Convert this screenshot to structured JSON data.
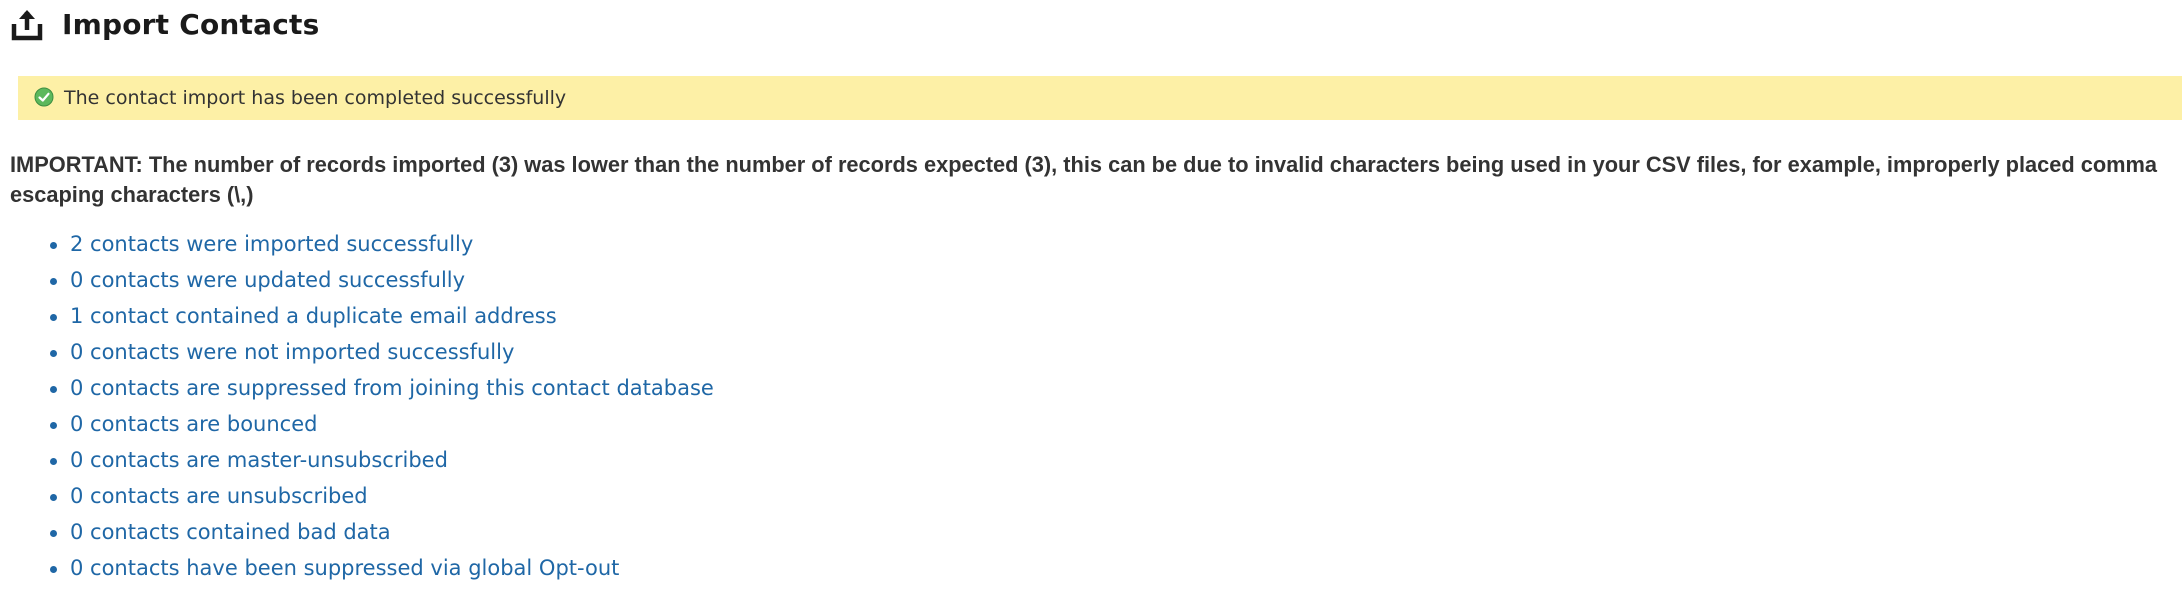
{
  "header": {
    "title": "Import Contacts",
    "icon": "upload-tray-icon"
  },
  "notice": {
    "icon": "success-check-icon",
    "text": "The contact import has been completed successfully",
    "background": "#fdf0a6",
    "icon_color": "#4caf50"
  },
  "important_text": "IMPORTANT: The number of records imported (3) was lower than the number of records expected (3), this can be due to invalid characters being used in your CSV files, for example, improperly placed comma escaping characters (\\,)",
  "results": [
    "2 contacts were imported successfully",
    "0 contacts were updated successfully",
    "1 contact contained a duplicate email address",
    "0 contacts were not imported successfully",
    "0 contacts are suppressed from joining this contact database",
    "0 contacts are bounced",
    "0 contacts are master-unsubscribed",
    "0 contacts are unsubscribed",
    "0 contacts contained bad data",
    "0 contacts have been suppressed via global Opt-out"
  ],
  "colors": {
    "link": "#1f67a6",
    "text": "#333333"
  }
}
